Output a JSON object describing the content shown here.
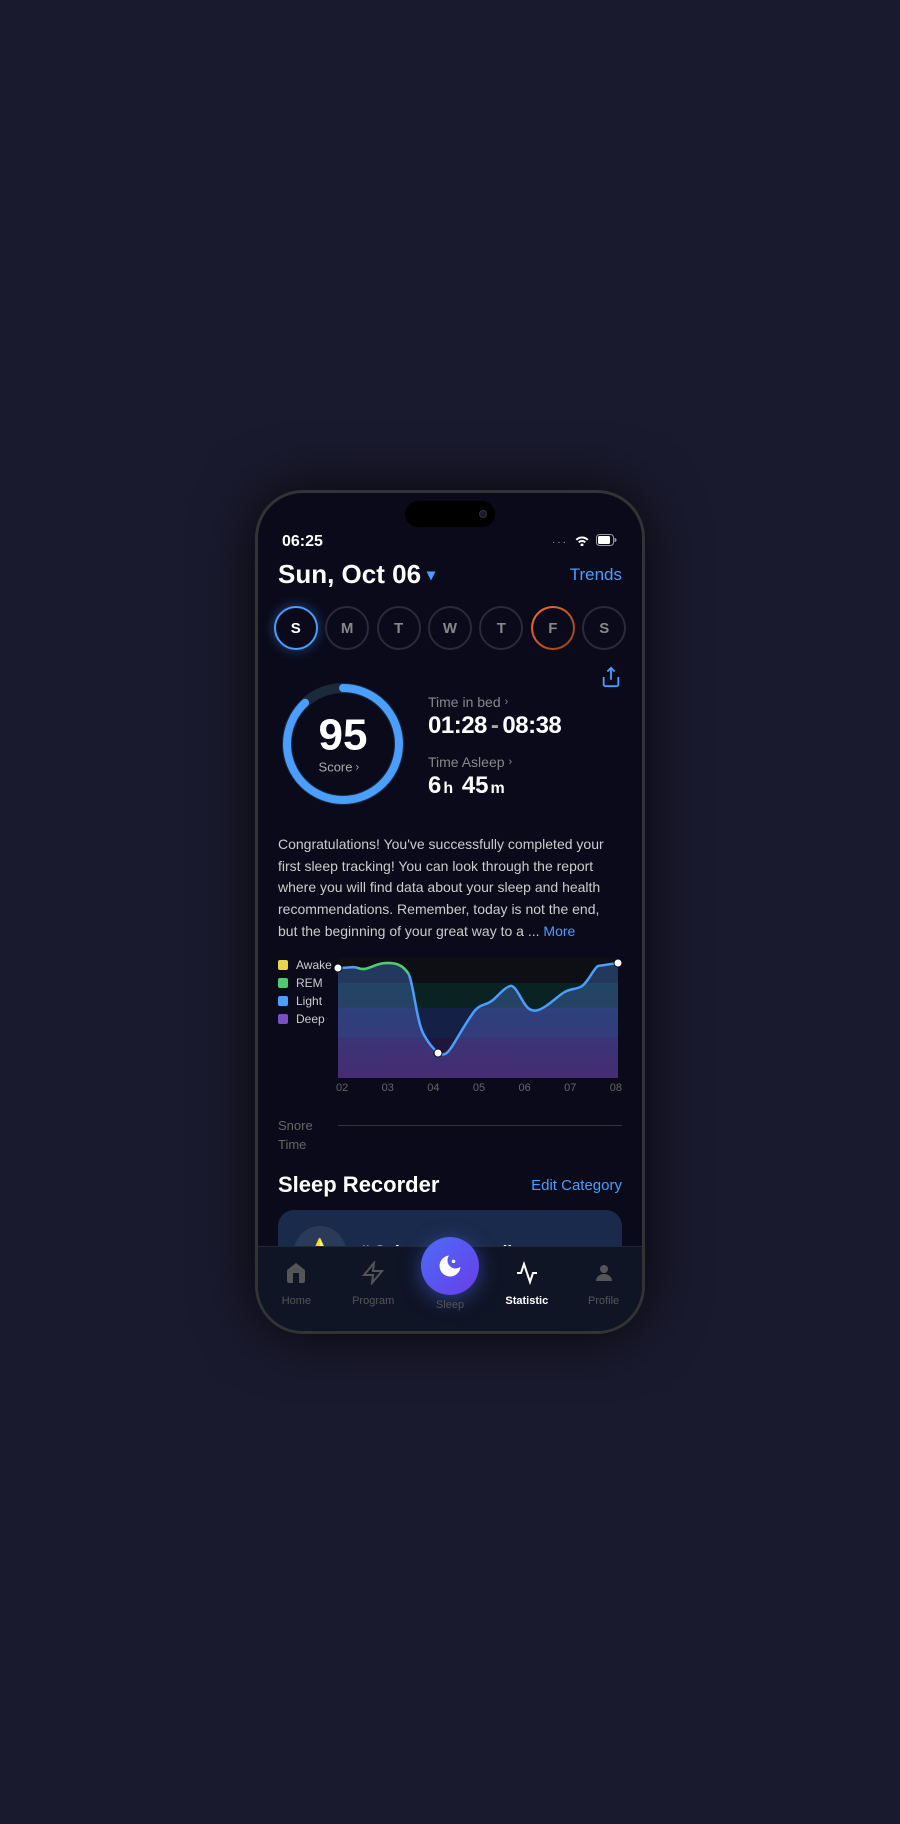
{
  "status": {
    "time": "06:25",
    "dots": "···",
    "wifi": "wifi",
    "battery": "battery"
  },
  "header": {
    "date": "Sun, Oct 06",
    "chevron": "▾",
    "trends_label": "Trends"
  },
  "week_days": [
    {
      "label": "S",
      "active": true,
      "has_data": false
    },
    {
      "label": "M",
      "active": false,
      "has_data": false
    },
    {
      "label": "T",
      "active": false,
      "has_data": false
    },
    {
      "label": "W",
      "active": false,
      "has_data": false
    },
    {
      "label": "T",
      "active": false,
      "has_data": false
    },
    {
      "label": "F",
      "active": false,
      "has_data": true
    },
    {
      "label": "S",
      "active": false,
      "has_data": false
    }
  ],
  "score": {
    "value": "95",
    "label": "Score",
    "chevron": "›"
  },
  "sleep_times": {
    "time_in_bed_label": "Time in bed",
    "time_in_bed_chevron": "›",
    "time_in_bed_value": "01:28 - 08:38",
    "time_asleep_label": "Time Asleep",
    "time_asleep_chevron": "›",
    "time_asleep_hours": "6",
    "time_asleep_h": "h",
    "time_asleep_minutes": "45",
    "time_asleep_m": "m"
  },
  "description": {
    "text": "Congratulations! You've successfully completed your first sleep tracking! You can look through the report where you will find data about your sleep and health recommendations. Remember, today is not the end, but the beginning of your great way to a ...",
    "more_label": "More"
  },
  "chart": {
    "legend": [
      {
        "label": "Awake",
        "color": "#e8d44d"
      },
      {
        "label": "REM",
        "color": "#4ecb6e"
      },
      {
        "label": "Light",
        "color": "#4a9eff"
      },
      {
        "label": "Deep",
        "color": "#7b4fc4"
      }
    ],
    "time_labels": [
      "02",
      "03",
      "04",
      "05",
      "06",
      "07",
      "08"
    ],
    "time_prefix": "Time",
    "snore_label": "Snore"
  },
  "sleep_recorder": {
    "title": "Sleep Recorder",
    "edit_category_label": "Edit Category",
    "card_title": "# Selected Recordings",
    "star_icon": "⭐"
  },
  "bottom_nav": {
    "items": [
      {
        "label": "Home",
        "icon": "home",
        "active": false
      },
      {
        "label": "Program",
        "icon": "program",
        "active": false
      },
      {
        "label": "Sleep",
        "icon": "sleep",
        "active": false,
        "is_center": true
      },
      {
        "label": "Statistic",
        "icon": "statistic",
        "active": true
      },
      {
        "label": "Profile",
        "icon": "profile",
        "active": false
      }
    ]
  }
}
